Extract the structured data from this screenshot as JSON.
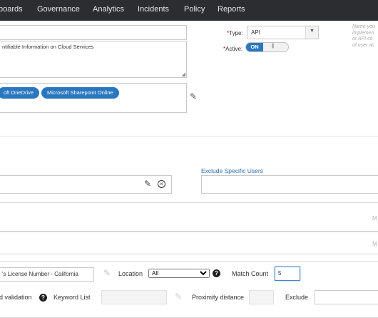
{
  "nav": {
    "items": [
      "boards",
      "Governance",
      "Analytics",
      "Incidents",
      "Policy",
      "Reports"
    ]
  },
  "policy": {
    "description_text": "ntifiable Information on Cloud Services",
    "type_label": "Type:",
    "type_value": "API",
    "active_label": "Active:",
    "active_state": "ON",
    "services": [
      "oft OneDrive",
      "Microsoft Sharepoint Online"
    ],
    "hint_lines": [
      "Name you",
      "implemen",
      "or API co",
      "of user ac"
    ]
  },
  "users": {
    "exclude_label": "Exclude Specific Users"
  },
  "panels": {
    "row1_right": "M",
    "row2_right": "M"
  },
  "rule": {
    "identifier_value": "'s License Number - California",
    "location_label": "Location",
    "location_value": "All",
    "location_options": [
      "All"
    ],
    "match_count_label": "Match Count",
    "match_count_value": "5",
    "validation_label": "d validation",
    "keyword_label": "Keyword List",
    "proximity_label": "Proximity distance",
    "exclude_label": "Exclude"
  },
  "colors": {
    "nav_bg": "#2b2d31",
    "accent": "#2a77c0",
    "required": "#c00000"
  }
}
